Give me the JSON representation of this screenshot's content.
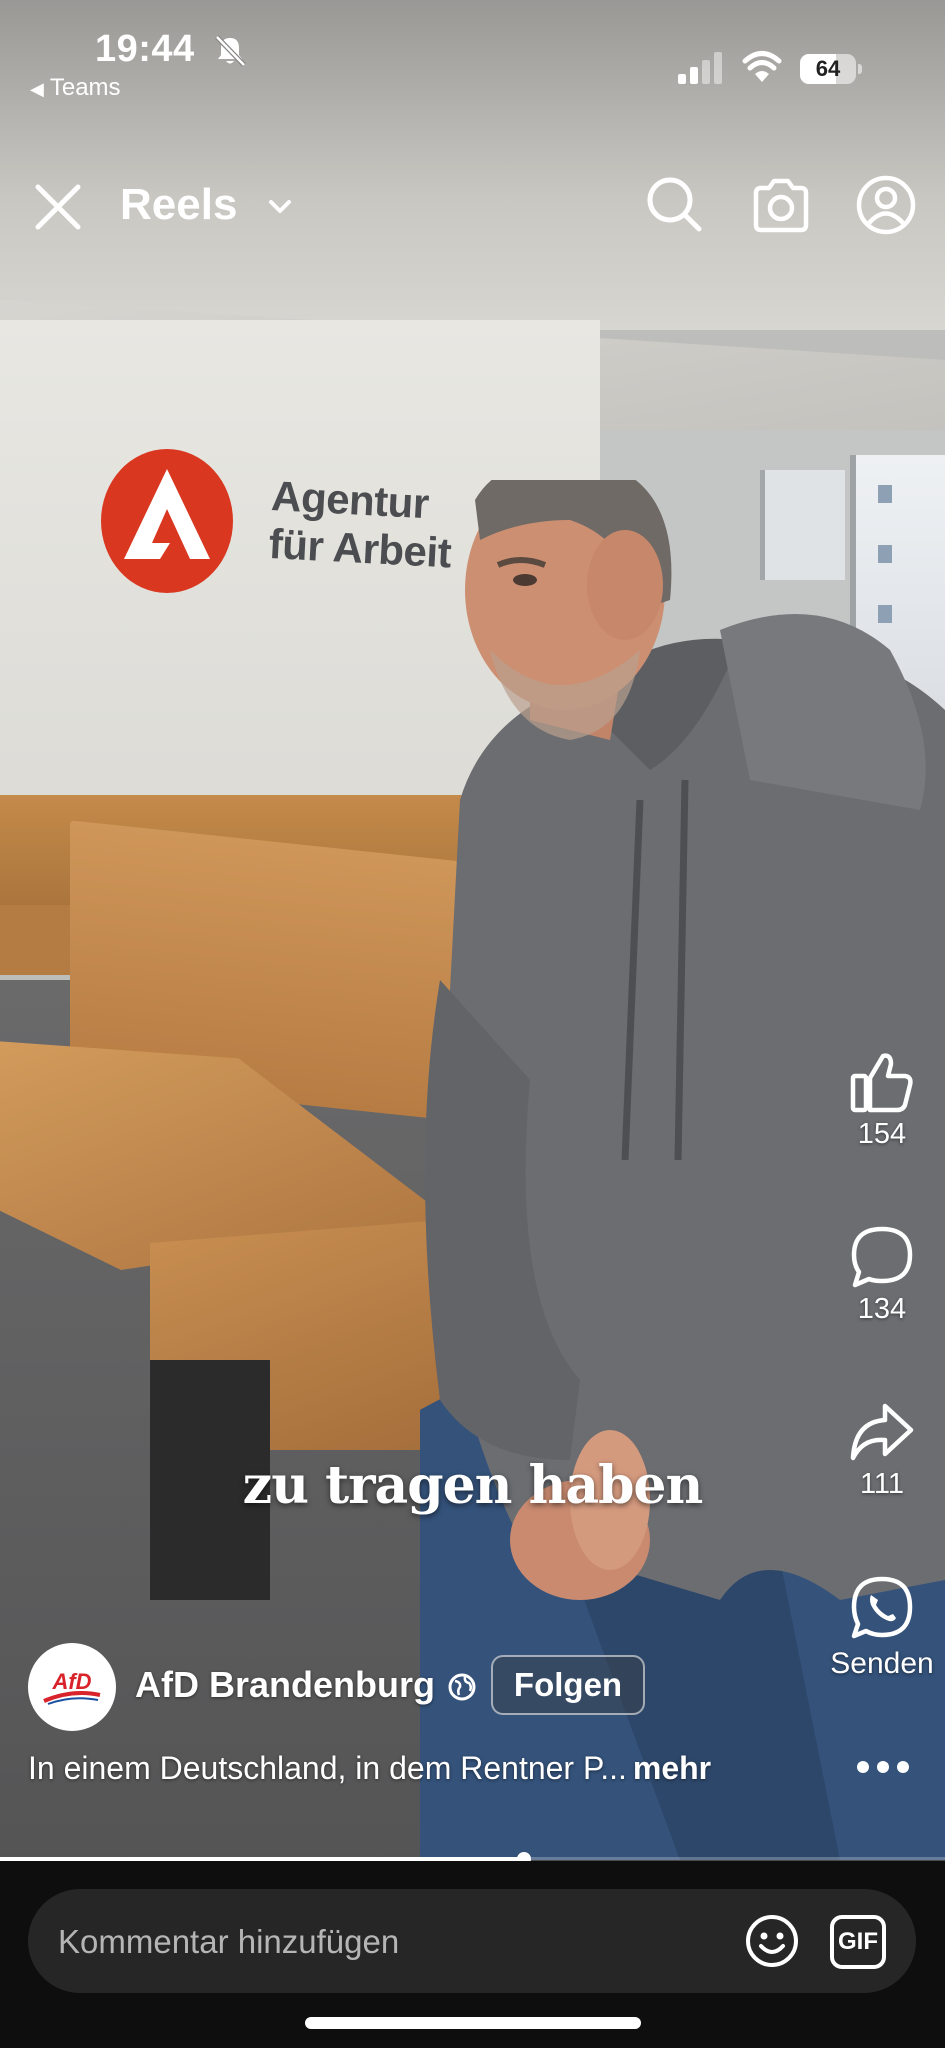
{
  "status_bar": {
    "time": "19:44",
    "back_app": "Teams",
    "battery": "64",
    "battery_level": 0.64
  },
  "top_bar": {
    "title": "Reels"
  },
  "wall_sign": {
    "line1": "Agentur",
    "line2": "für Arbeit"
  },
  "caption": "zu tragen haben",
  "actions": {
    "likes": "154",
    "comments": "134",
    "shares": "111",
    "send_label": "Senden"
  },
  "post": {
    "avatar_text": "AfD",
    "account_name": "AfD Brandenburg",
    "follow_label": "Folgen",
    "description": "In einem Deutschland, in dem Rentner P...",
    "more_label": "mehr"
  },
  "playback": {
    "progress": 0.555
  },
  "comment_bar": {
    "placeholder": "Kommentar hinzufügen",
    "gif_label": "GIF"
  },
  "colors": {
    "accent_red": "#d9371f",
    "background": "#0e0e0e",
    "input_bg": "#262626"
  }
}
